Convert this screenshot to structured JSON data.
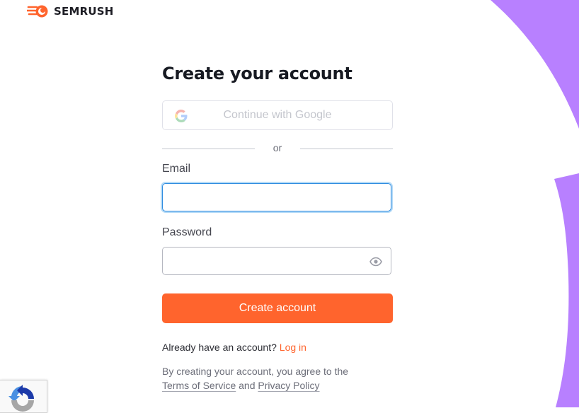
{
  "brand": {
    "name": "SEMRUSH",
    "accent": "#ff642d",
    "decor_color": "#b880ff"
  },
  "form": {
    "title": "Create your account",
    "google_button": "Continue with Google",
    "divider": "or",
    "email_label": "Email",
    "email_value": "",
    "password_label": "Password",
    "password_value": "",
    "submit": "Create account"
  },
  "login": {
    "prompt": "Already have an account?",
    "link": "Log in"
  },
  "terms": {
    "prefix": "By creating your account, you agree to the",
    "terms_link": "Terms of Service",
    "conjunction": "and",
    "privacy_link": "Privacy Policy"
  },
  "icons": {
    "logo": "semrush-fireball-icon",
    "google": "google-g-icon",
    "password_toggle": "eye-icon",
    "recaptcha": "recaptcha-icon"
  }
}
